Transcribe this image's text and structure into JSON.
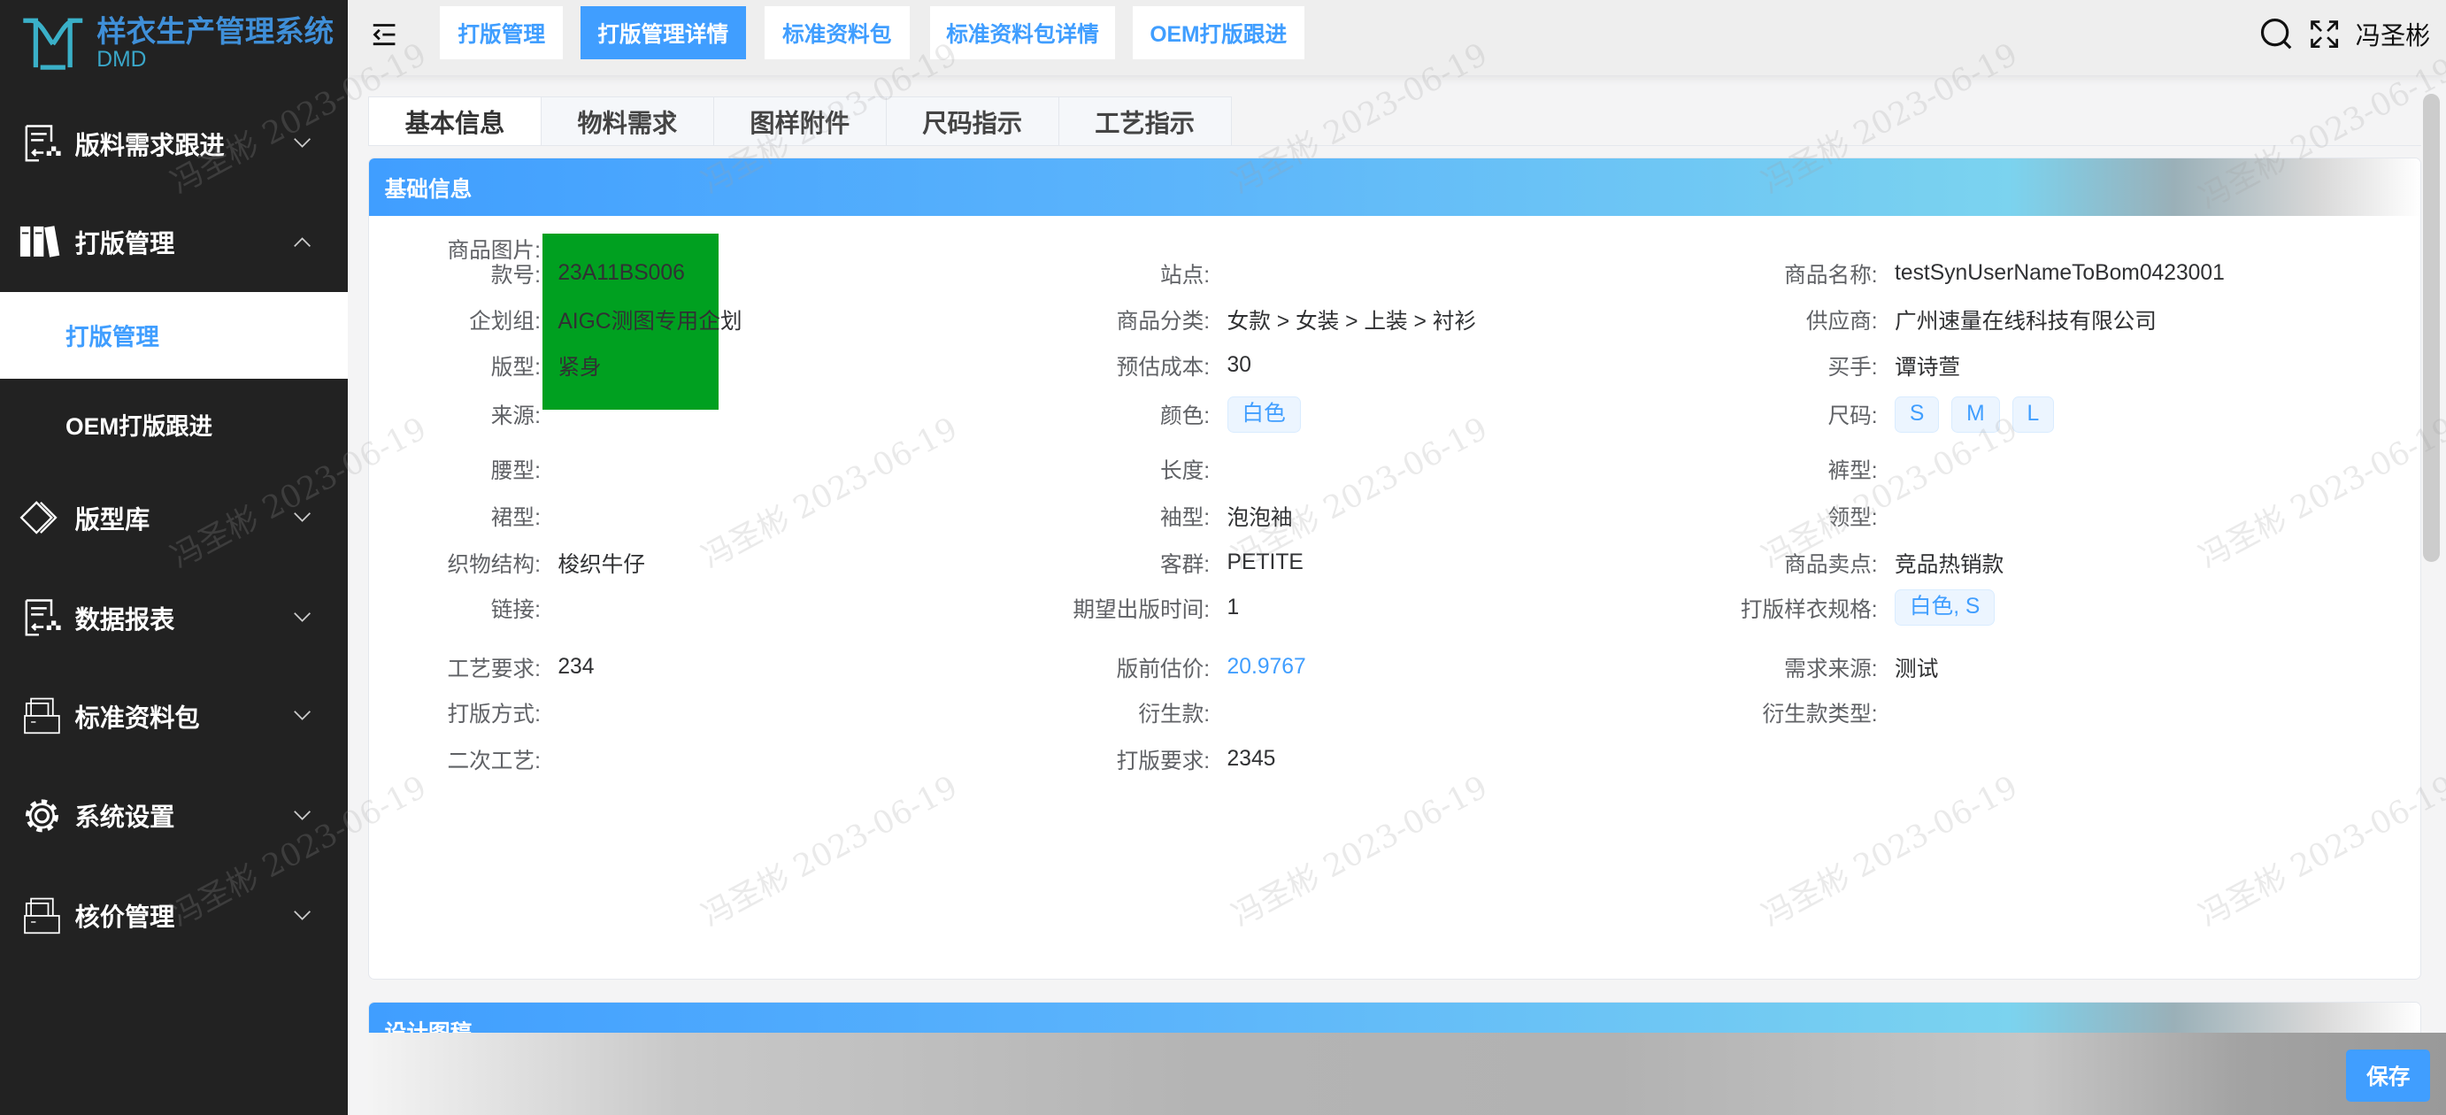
{
  "app": {
    "title": "样衣生产管理系统",
    "subtitle": "DMD",
    "accent": "#409eff"
  },
  "sidebar": {
    "items": [
      {
        "label": "版料需求跟进",
        "icon": "report-icon",
        "expanded": false
      },
      {
        "label": "打版管理",
        "icon": "books-icon",
        "expanded": true
      },
      {
        "label": "版型库",
        "icon": "layers-icon",
        "expanded": false
      },
      {
        "label": "数据报表",
        "icon": "report-icon",
        "expanded": false
      },
      {
        "label": "标准资料包",
        "icon": "bom-folder-icon",
        "expanded": false
      },
      {
        "label": "系统设置",
        "icon": "gear-icon",
        "expanded": false
      },
      {
        "label": "核价管理",
        "icon": "bom-folder-icon",
        "expanded": false
      }
    ],
    "subitems": [
      {
        "label": "打版管理",
        "active": true
      },
      {
        "label": "OEM打版跟进",
        "active": false
      }
    ]
  },
  "header": {
    "tabs": [
      {
        "label": "打版管理"
      },
      {
        "label": "打版管理详情",
        "active": true
      },
      {
        "label": "标准资料包"
      },
      {
        "label": "标准资料包详情"
      },
      {
        "label": "OEM打版跟进"
      }
    ],
    "user": "冯圣彬"
  },
  "content_tabs": [
    "基本信息",
    "物料需求",
    "图样附件",
    "尺码指示",
    "工艺指示"
  ],
  "basic": {
    "title": "基础信息",
    "image_label": "商品图片:",
    "image_color": "#00a020",
    "fields": [
      {
        "label": "款号:",
        "value": "23A11BS006"
      },
      {
        "label": "站点:",
        "value": ""
      },
      {
        "label": "商品名称:",
        "value": "testSynUserNameToBom0423001"
      },
      {
        "label": "企划组:",
        "value": "AIGC测图专用企划"
      },
      {
        "label": "商品分类:",
        "value": "女款 > 女装 > 上装 > 衬衫"
      },
      {
        "label": "供应商:",
        "value": "广州速量在线科技有限公司"
      },
      {
        "label": "版型:",
        "value": "紧身"
      },
      {
        "label": "预估成本:",
        "value": "30"
      },
      {
        "label": "买手:",
        "value": "谭诗萱"
      },
      {
        "label": "来源:",
        "value": ""
      },
      {
        "label": "颜色:",
        "tags": [
          "白色"
        ]
      },
      {
        "label": "尺码:",
        "tags": [
          "S",
          "M",
          "L"
        ]
      },
      {
        "label": "腰型:",
        "value": ""
      },
      {
        "label": "长度:",
        "value": ""
      },
      {
        "label": "裤型:",
        "value": ""
      },
      {
        "label": "裙型:",
        "value": ""
      },
      {
        "label": "袖型:",
        "value": "泡泡袖"
      },
      {
        "label": "领型:",
        "value": ""
      },
      {
        "label": "织物结构:",
        "value": "梭织牛仔"
      },
      {
        "label": "客群:",
        "value": "PETITE"
      },
      {
        "label": "商品卖点:",
        "value": "竞品热销款"
      },
      {
        "label": "链接:",
        "value": ""
      },
      {
        "label": "期望出版时间:",
        "value": "1"
      },
      {
        "label": "打版样衣规格:",
        "tags": [
          "白色, S"
        ]
      },
      {
        "label": "工艺要求:",
        "value": "234"
      },
      {
        "label": "版前估价:",
        "value": "20.9767",
        "link": true
      },
      {
        "label": "需求来源:",
        "value": "测试"
      },
      {
        "label": "打版方式:",
        "value": ""
      },
      {
        "label": "衍生款:",
        "value": ""
      },
      {
        "label": "衍生款类型:",
        "value": ""
      },
      {
        "label": "二次工艺:",
        "value": ""
      },
      {
        "label": "打版要求:",
        "value": "2345"
      }
    ]
  },
  "design": {
    "title": "设计图稿"
  },
  "footer": {
    "save_label": "保存"
  },
  "watermark": "冯圣彬 2023-06-19"
}
